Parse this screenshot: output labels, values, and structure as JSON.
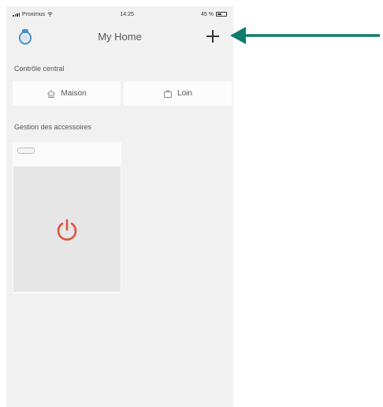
{
  "status_bar": {
    "carrier": "Proximus",
    "time": "14:25",
    "battery": "45 %"
  },
  "nav": {
    "title": "My Home",
    "left_icon": "home-avatar-icon",
    "right_icon": "plus-icon"
  },
  "central_control": {
    "label": "Contrôle central",
    "buttons": [
      {
        "label": "Maison",
        "icon": "house-icon"
      },
      {
        "label": "Loin",
        "icon": "suitcase-icon"
      }
    ]
  },
  "accessories": {
    "label": "Gestion des accessoires",
    "items": [
      {
        "icon": "power-icon",
        "state_color": "#e0503f"
      }
    ]
  },
  "annotation": {
    "arrow_color": "#0e7c6b",
    "icon": "arrow-left-icon"
  },
  "colors": {
    "screen_bg": "#f1f1f1",
    "card_bg": "#fafafa",
    "accent_red": "#e0503f"
  }
}
